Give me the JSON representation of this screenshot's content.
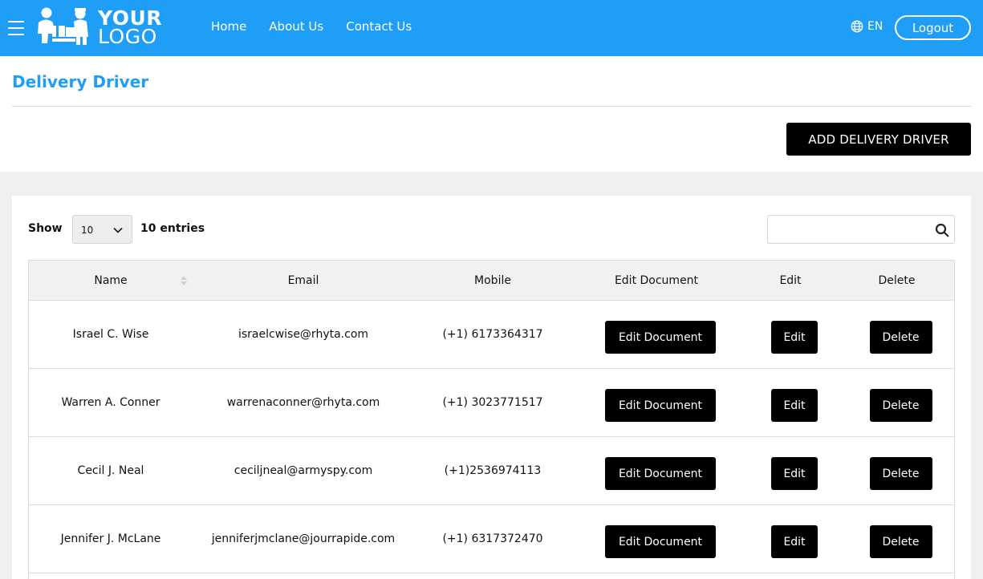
{
  "header": {
    "logo": {
      "line1": "YOUR",
      "line2": "LOGO"
    },
    "nav": [
      "Home",
      "About Us",
      "Contact Us"
    ],
    "language": "EN",
    "logout_label": "Logout",
    "brand_color": "#1e9ef6"
  },
  "page": {
    "title": "Delivery Driver",
    "add_button": "ADD DELIVERY DRIVER"
  },
  "table_controls": {
    "show_label": "Show",
    "page_length": "10",
    "entries_label": "10 entries",
    "search_value": "",
    "search_placeholder": ""
  },
  "table": {
    "columns": [
      "Name",
      "Email",
      "Mobile",
      "Edit Document",
      "Edit",
      "Delete"
    ],
    "rows": [
      {
        "name": "Israel C. Wise",
        "email": "israelcwise@rhyta.com",
        "mobile": "(+1) 6173364317"
      },
      {
        "name": "Warren A. Conner",
        "email": "warrenaconner@rhyta.com",
        "mobile": "(+1) 3023771517"
      },
      {
        "name": "Cecil J. Neal",
        "email": "ceciljneal@armyspy.com",
        "mobile": "(+1)2536974113"
      },
      {
        "name": "Jennifer J. McLane",
        "email": "jenniferjmclane@jourrapide.com",
        "mobile": "(+1) 6317372470"
      }
    ],
    "actions": {
      "edit_document": "Edit Document",
      "edit": "Edit",
      "delete": "Delete"
    }
  },
  "icons": {
    "menu": "hamburger-icon",
    "language": "globe-icon",
    "search": "search-icon",
    "select": "chevron-down-icon",
    "sort": "sort-icon"
  }
}
